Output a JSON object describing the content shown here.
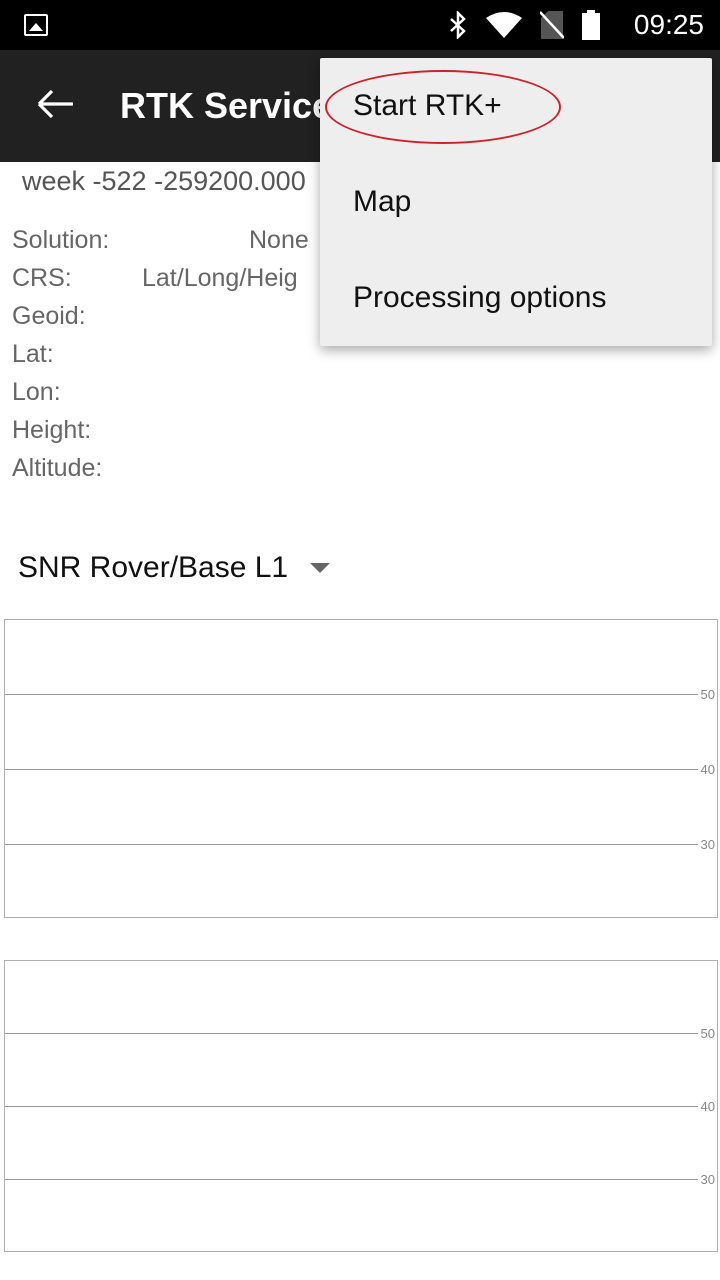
{
  "status_bar": {
    "time": "09:25",
    "icons": [
      "image-notification-icon",
      "bluetooth-icon",
      "wifi-icon",
      "no-sim-icon",
      "battery-icon"
    ]
  },
  "app_bar": {
    "back_icon": "arrow-left-icon",
    "title": "RTK Service"
  },
  "solution_info": {
    "week_text": "week -522 -259200.000",
    "rows": [
      {
        "label": "Solution:",
        "value": "None"
      },
      {
        "label": "CRS:",
        "value": "Lat/Long/Heig"
      },
      {
        "label": "Geoid:",
        "value": ""
      },
      {
        "label": "Lat:",
        "value": ""
      },
      {
        "label": "Lon:",
        "value": ""
      },
      {
        "label": "Height:",
        "value": ""
      },
      {
        "label": "Altitude:",
        "value": ""
      }
    ]
  },
  "snr_selector": {
    "selected": "SNR Rover/Base L1"
  },
  "charts": [
    {
      "ticks": [
        "50",
        "40",
        "30"
      ]
    },
    {
      "ticks": [
        "50",
        "40",
        "30"
      ]
    }
  ],
  "overflow_menu": {
    "items": [
      {
        "label": "Start RTK+"
      },
      {
        "label": "Map"
      },
      {
        "label": "Processing options"
      }
    ]
  },
  "colors": {
    "status_bar_bg": "#000000",
    "app_bar_bg": "#212121",
    "menu_bg": "#eeeeee",
    "highlight": "#d0202a"
  }
}
